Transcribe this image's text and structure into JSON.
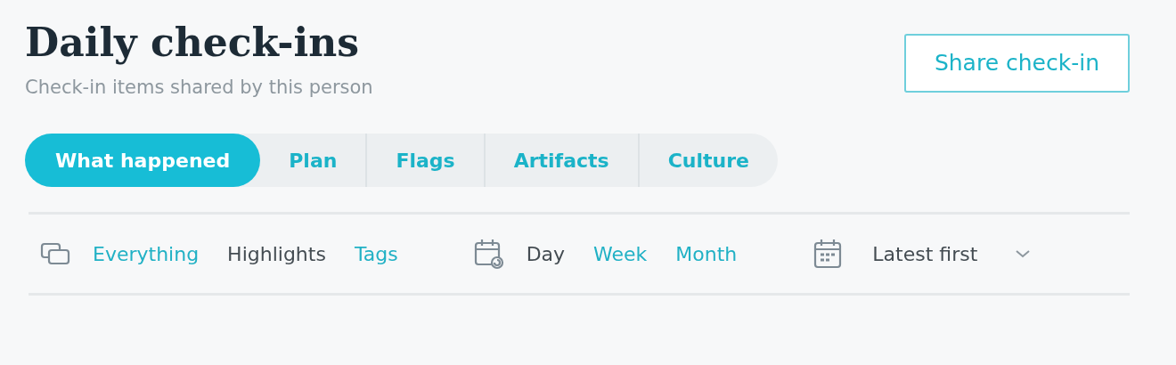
{
  "header": {
    "title": "Daily check-ins",
    "subtitle": "Check-in items shared by this person",
    "share_button": "Share check-in"
  },
  "tabs": [
    {
      "label": "What happened",
      "selected": true
    },
    {
      "label": "Plan",
      "selected": false
    },
    {
      "label": "Flags",
      "selected": false
    },
    {
      "label": "Artifacts",
      "selected": false
    },
    {
      "label": "Culture",
      "selected": false
    }
  ],
  "content_filters": [
    {
      "label": "Everything",
      "selected": false
    },
    {
      "label": "Highlights",
      "selected": true
    },
    {
      "label": "Tags",
      "selected": false
    }
  ],
  "period_filters": [
    {
      "label": "Day",
      "selected": true
    },
    {
      "label": "Week",
      "selected": false
    },
    {
      "label": "Month",
      "selected": false
    }
  ],
  "sort": {
    "value": "Latest first"
  }
}
